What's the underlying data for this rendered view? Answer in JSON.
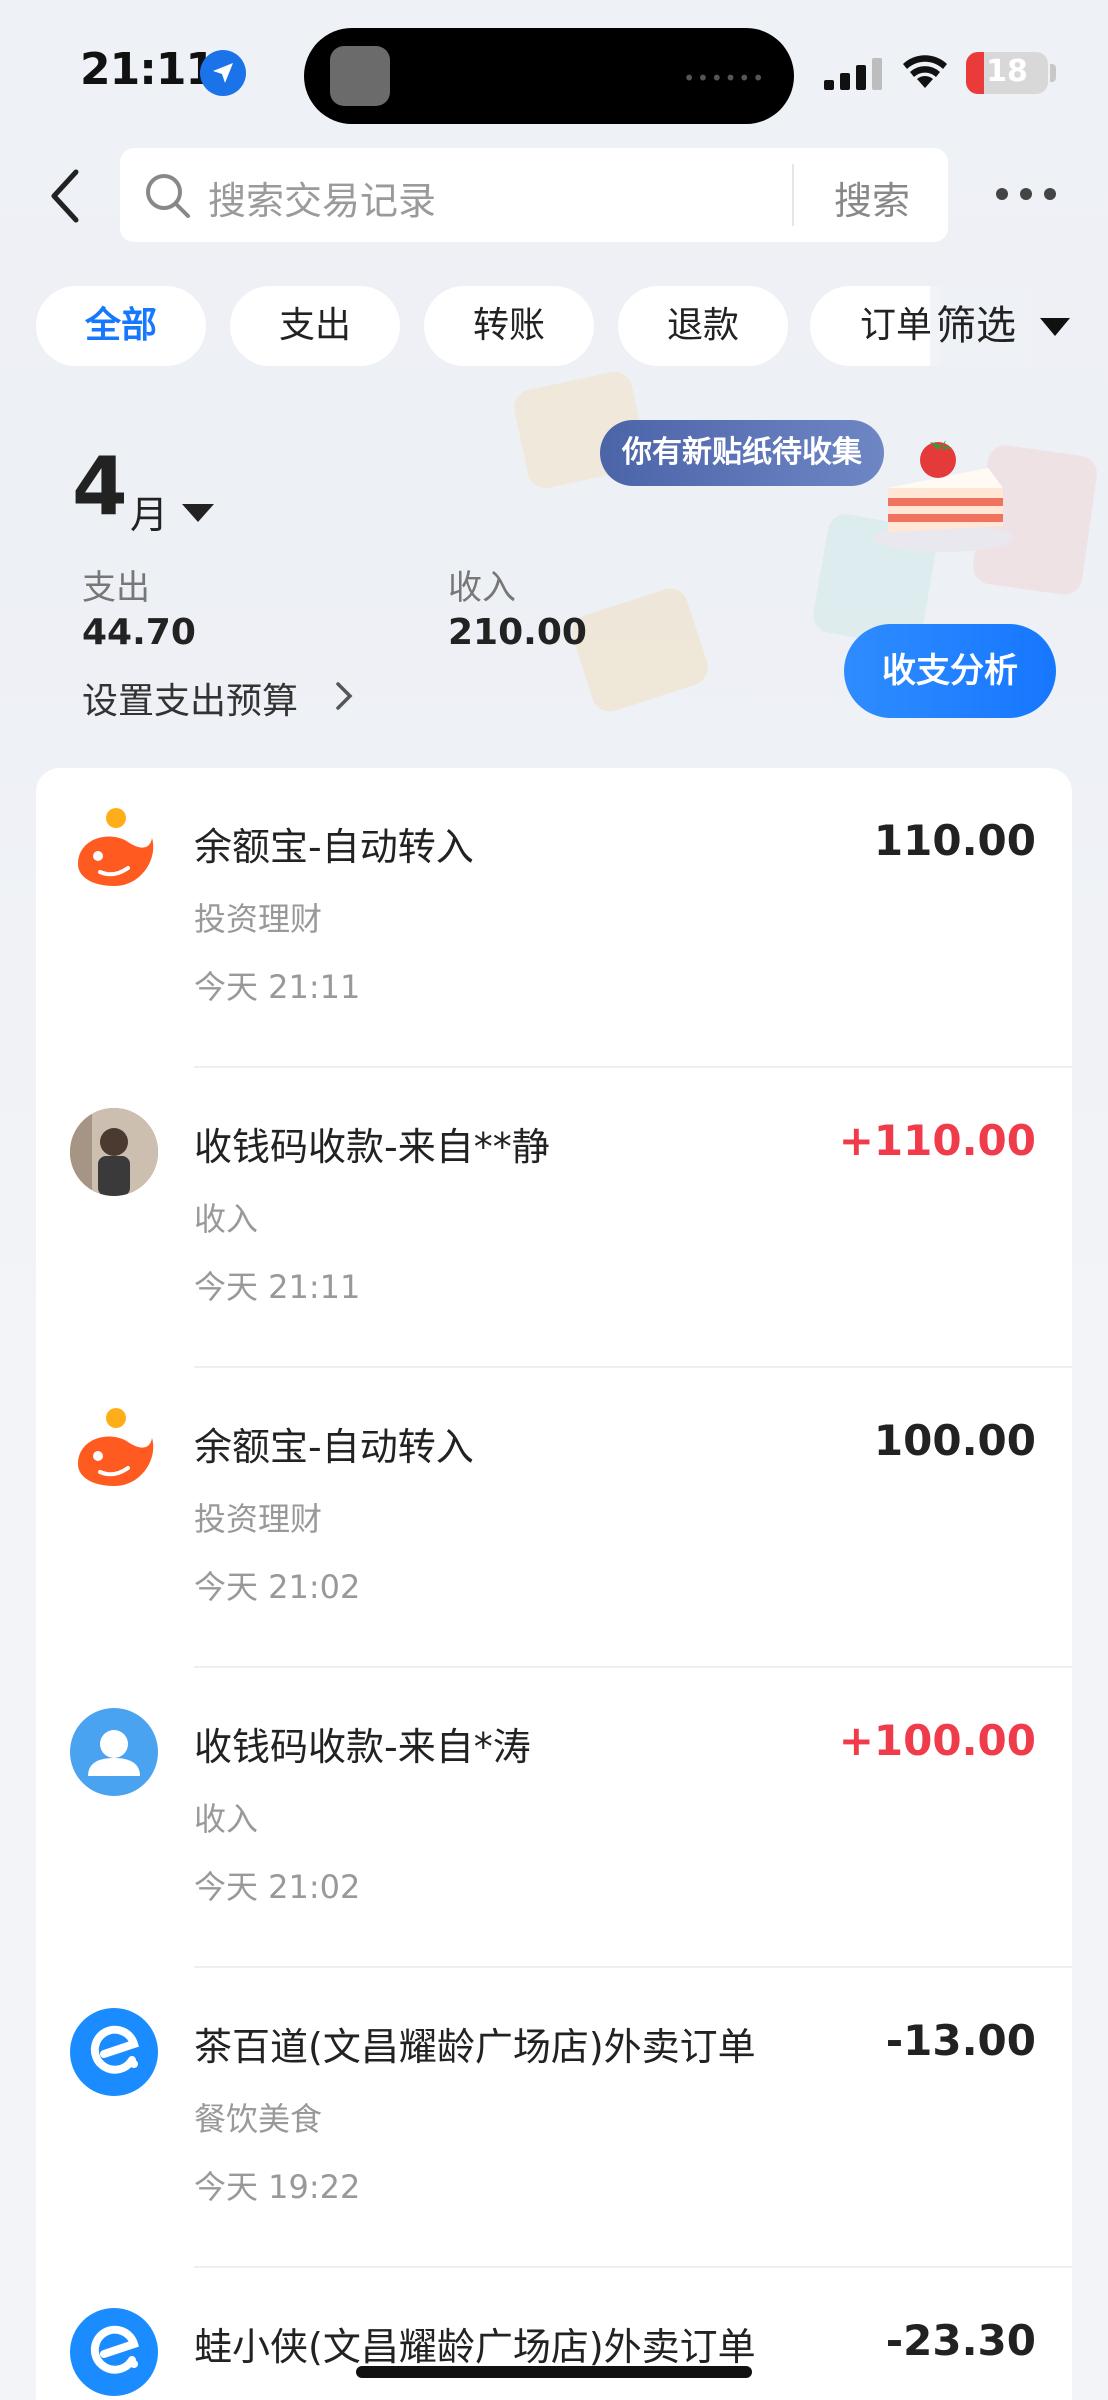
{
  "status_bar": {
    "time": "21:11",
    "battery": "18",
    "location_icon": "location-arrow-icon",
    "wifi_icon": "wifi-icon",
    "signal_icon": "cellular-signal-icon"
  },
  "search": {
    "placeholder": "搜索交易记录",
    "button": "搜索"
  },
  "chips": [
    {
      "label": "全部",
      "active": true
    },
    {
      "label": "支出",
      "active": false
    },
    {
      "label": "转账",
      "active": false
    },
    {
      "label": "退款",
      "active": false
    },
    {
      "label": "订单",
      "active": false
    }
  ],
  "filter_label": "筛选",
  "summary": {
    "month_num": "4",
    "month_unit": "月",
    "expense_label": "支出",
    "expense_value": "44.70",
    "income_label": "收入",
    "income_value": "210.00",
    "budget_label": "设置支出预算",
    "sticker_text": "你有新贴纸待收集",
    "analysis_button": "收支分析"
  },
  "transactions": [
    {
      "title": "余额宝-自动转入",
      "category": "投资理财",
      "time": "今天 21:11",
      "amount": "110.00",
      "icon": "yuebao-icon",
      "positive": false
    },
    {
      "title": "收钱码收款-来自**静",
      "category": "收入",
      "time": "今天 21:11",
      "amount": "+110.00",
      "icon": "user-photo-avatar",
      "positive": true
    },
    {
      "title": "余额宝-自动转入",
      "category": "投资理财",
      "time": "今天 21:02",
      "amount": "100.00",
      "icon": "yuebao-icon",
      "positive": false
    },
    {
      "title": "收钱码收款-来自*涛",
      "category": "收入",
      "time": "今天 21:02",
      "amount": "+100.00",
      "icon": "default-user-icon",
      "positive": true
    },
    {
      "title": "茶百道(文昌耀龄广场店)外卖订单",
      "category": "餐饮美食",
      "time": "今天 19:22",
      "amount": "-13.00",
      "icon": "eleme-icon",
      "positive": false
    },
    {
      "title": "蛙小侠(文昌耀龄广场店)外卖订单",
      "category": "",
      "time": "",
      "amount": "-23.30",
      "icon": "eleme-icon",
      "positive": false
    }
  ],
  "colors": {
    "accent": "#1677ff",
    "income": "#f03b4b",
    "yuebao": "#ff5a1f",
    "sticker": "#5a72b6"
  }
}
